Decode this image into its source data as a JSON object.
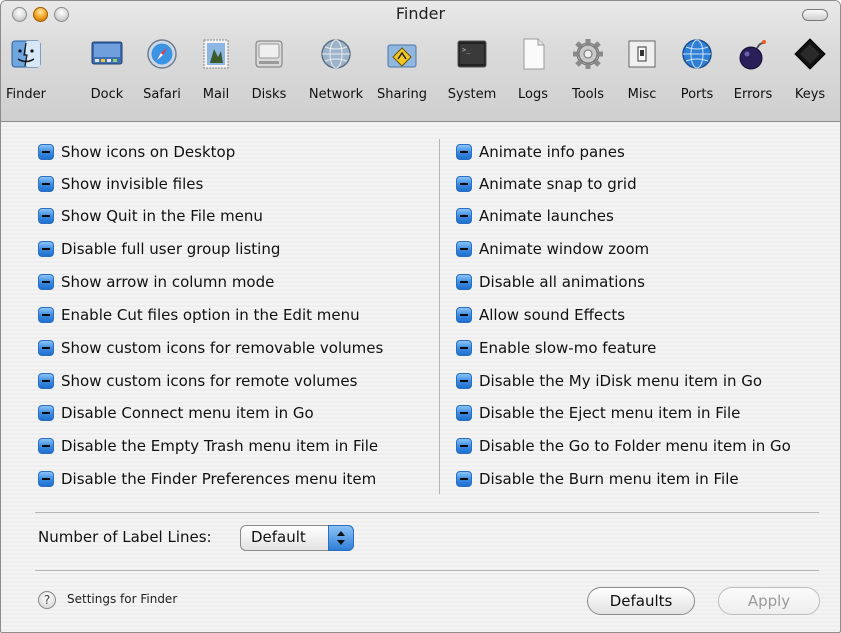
{
  "window": {
    "title": "Finder"
  },
  "toolbar": [
    {
      "label": "Finder",
      "icon": "finder-icon"
    },
    {
      "label": "Dock",
      "icon": "dock-icon"
    },
    {
      "label": "Safari",
      "icon": "safari-compass-icon"
    },
    {
      "label": "Mail",
      "icon": "mail-stamp-icon"
    },
    {
      "label": "Disks",
      "icon": "hard-disk-icon"
    },
    {
      "label": "Network",
      "icon": "network-globe-icon"
    },
    {
      "label": "Sharing",
      "icon": "sharing-folder-icon"
    },
    {
      "label": "System",
      "icon": "terminal-icon"
    },
    {
      "label": "Logs",
      "icon": "document-icon"
    },
    {
      "label": "Tools",
      "icon": "gear-icon"
    },
    {
      "label": "Misc",
      "icon": "switch-icon"
    },
    {
      "label": "Ports",
      "icon": "ports-globe-icon"
    },
    {
      "label": "Errors",
      "icon": "bomb-icon"
    },
    {
      "label": "Keys",
      "icon": "key-icon"
    }
  ],
  "left_options": [
    "Show icons on Desktop",
    "Show invisible files",
    "Show Quit in the File menu",
    "Disable full user group listing",
    "Show arrow in column mode",
    "Enable Cut files option in the Edit menu",
    "Show custom icons for removable volumes",
    "Show custom icons for remote volumes",
    "Disable Connect menu item in Go",
    "Disable the Empty Trash menu item in File",
    "Disable the Finder Preferences menu item"
  ],
  "right_options": [
    "Animate info panes",
    "Animate snap to grid",
    "Animate launches",
    "Animate window zoom",
    "Disable all animations",
    "Allow sound Effects",
    "Enable slow-mo feature",
    "Disable the My iDisk menu item in Go",
    "Disable the Eject menu item in File",
    "Disable the Go to Folder menu item in Go",
    "Disable the Burn menu item in File"
  ],
  "label_lines": {
    "label": "Number of Label Lines:",
    "value": "Default"
  },
  "footer": {
    "help_symbol": "?",
    "settings_text": "Settings for Finder",
    "defaults_button": "Defaults",
    "apply_button": "Apply"
  },
  "colors": {
    "checkbox_accent": "#3c8de2",
    "toolbar_bg": "#d6d6d6"
  }
}
